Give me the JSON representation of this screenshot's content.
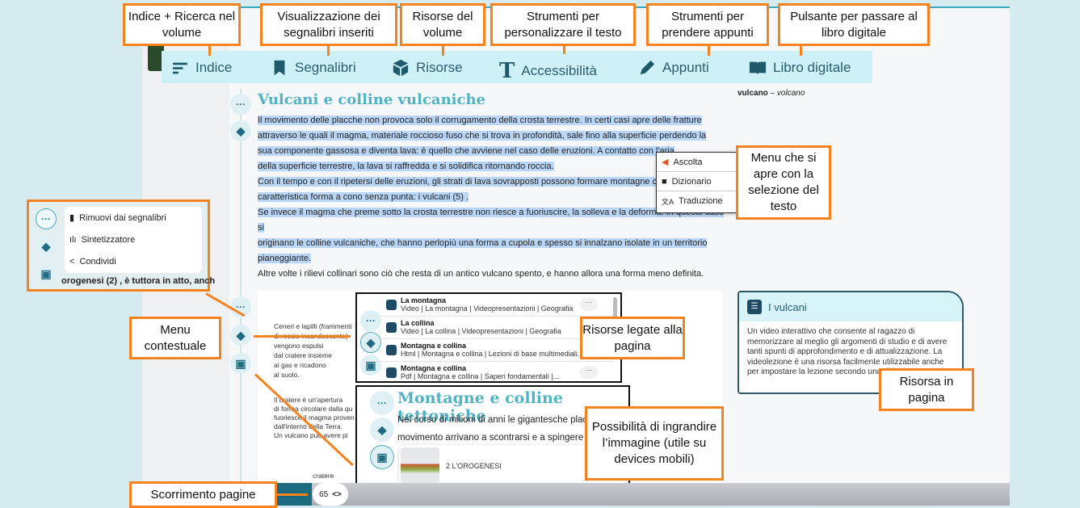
{
  "toolbar": {
    "items": [
      {
        "label": "Indice",
        "icon": "list-icon"
      },
      {
        "label": "Segnalibri",
        "icon": "bookmark-icon"
      },
      {
        "label": "Risorse",
        "icon": "cube-icon"
      },
      {
        "label": "Accessibilità",
        "icon": "text-icon"
      },
      {
        "label": "Appunti",
        "icon": "pen-icon"
      },
      {
        "label": "Libro digitale",
        "icon": "book-icon"
      }
    ]
  },
  "callouts": {
    "indice": "Indice + Ricerca nel volume",
    "segnalibri": "Visualizzazione dei segnalibri inseriti",
    "risorse": "Risorse del volume",
    "accessibilita": "Strumenti per personalizzare il testo",
    "appunti": "Strumenti per prendere appunti",
    "libro": "Pulsante per passare al libro digitale",
    "selezione": "Menu che si apre con la selezione del testo",
    "contestuale": "Menu contestuale",
    "risorse_pagina": "Risorse legate alla pagina",
    "risorsa_in_pagina": "Risorsa in pagina",
    "ingrandire": "Possibilità di ingrandire l’immagine (utile su devices mobili)",
    "scorrimento": "Scorrimento pagine"
  },
  "glossary": {
    "term": "vulcano",
    "translation": "volcano"
  },
  "section1": {
    "title": "Vulcani e colline vulcaniche",
    "lines": [
      "Il movimento delle placche non provoca solo il corrugamento della crosta terrestre. In certi casi apre delle fratture",
      "attraverso le quali il magma, materiale roccioso fuso che si trova in profondità, sale fino alla superficie perdendo la",
      "sua componente gassosa e diventa lava: è quello che avviene nel caso delle eruzioni. A contatto con l'aria",
      "della superficie terrestre, la lava si raffredda e si solidifica ritornando roccia.",
      "Con il tempo e con il ripetersi delle eruzioni, gli strati di lava sovrapposti possono formare montagne con la",
      "caratteristica forma a cono senza punta: i vulcani (5) .",
      "Se invece il magma che preme sotto la crosta terrestre non riesce a fuoriuscire, la solleva e la deforma. In questo caso si",
      "originano le colline vulcaniche, che hanno perlopiù una forma a cupola e spesso si innalzano isolate in un territorio",
      "pianeggiante.",
      "Altre volte i rilievi collinari sono ciò che resta di un antico vulcano spento, e hanno allora una forma meno definita."
    ]
  },
  "selection_menu": [
    "Ascolta",
    "Dizionario",
    "Traduzione"
  ],
  "context_menu": [
    "Rimuovi dai segnalibri",
    "Sintetizzatore",
    "Condividi"
  ],
  "context_behind": "orogenesi (2) , è tuttora in atto, anch",
  "figure_text": {
    "ceneri": [
      "Ceneri e lapilli (frammenti",
      "di roccia incandescente)",
      "vengono espulsi",
      "dal cratere insieme",
      "ai gas e ricadono",
      "al suolo."
    ],
    "cratere": [
      "Il cratere è un'apertura",
      "di forma circolare dalla qu",
      "fuoriesce il magma proven",
      "dall'interno della Terra.",
      "Un vulcano può avere pi"
    ],
    "label": "cratere"
  },
  "resources": [
    {
      "title": "La montagna",
      "meta": "Video | La montagna | Videopresentazioni | Geografia"
    },
    {
      "title": "La collina",
      "meta": "Video | La collina | Videopresentazioni | Geografia"
    },
    {
      "title": "Montagna e collina",
      "meta": "Html | Montagna e collina | Lezioni di base multimediali..."
    },
    {
      "title": "Montagna e collina",
      "meta": "Pdf | Montagna e collina | Saperi fondamentali |..."
    }
  ],
  "section2": {
    "title": "Montagne e colline tettoniche",
    "lines": [
      "Nel corso di milioni di anni le gigantesche placche",
      "movimento arrivano a scontrarsi e a spingere co"
    ],
    "image_caption": "2 L'OROGENESI"
  },
  "card": {
    "title": "I vulcani",
    "body": "Un video interattivo che consente al ragazzo di memorizzare al meglio gli argomenti di studio e di avere tanti spunti di approfondimento e di attualizzazione. La videolezione è una risorsa facilmente utilizzabile anche per impostare la lezione secondo una didattica capovolta."
  },
  "pager": {
    "page": "65",
    "nav": "<>"
  },
  "colors": {
    "accent": "#f5821f",
    "teal": "#1f6b80",
    "toolbar": "#cdf1f6",
    "selection": "#b9d6f6"
  }
}
